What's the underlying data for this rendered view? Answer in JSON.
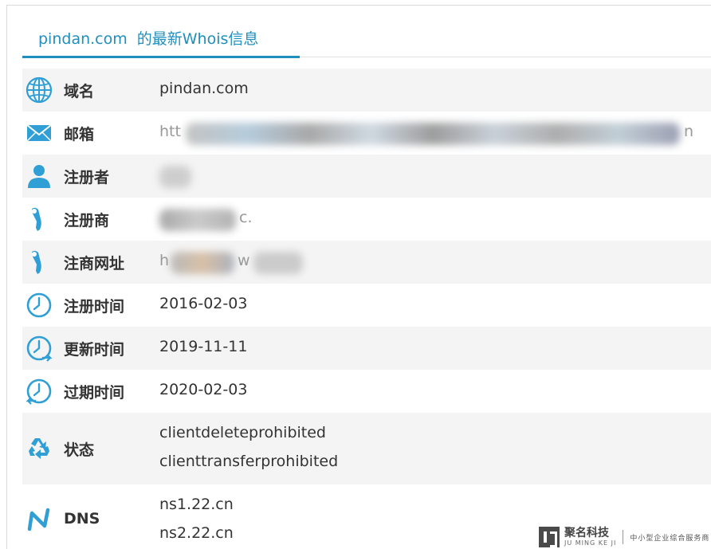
{
  "header": {
    "domain": "pindan.com",
    "suffix": "的最新Whois信息"
  },
  "colors": {
    "accent": "#1f8fbf",
    "row_alt": "#f4f4f4"
  },
  "rows": [
    {
      "icon": "globe-icon",
      "label": "域名",
      "value": "pindan.com"
    },
    {
      "icon": "mail-icon",
      "label": "邮箱",
      "value_prefix": "htt",
      "value_suffix": "n"
    },
    {
      "icon": "person-icon",
      "label": "注册者",
      "value": ""
    },
    {
      "icon": "pin-icon",
      "label": "注册商",
      "value_suffix": "c."
    },
    {
      "icon": "pin-icon",
      "label": "注商网址",
      "value_prefix": "h",
      "value_suffix": "w"
    },
    {
      "icon": "clock-icon",
      "label": "注册时间",
      "value": "2016-02-03"
    },
    {
      "icon": "clock-forward-icon",
      "label": "更新时间",
      "value": "2019-11-11"
    },
    {
      "icon": "clock-back-icon",
      "label": "过期时间",
      "value": "2020-02-03"
    },
    {
      "icon": "recycle-icon",
      "label": "状态",
      "values": [
        "clientdeleteprohibited",
        "clienttransferprohibited"
      ]
    },
    {
      "icon": "dns-icon",
      "label": "DNS",
      "values": [
        "ns1.22.cn",
        "ns2.22.cn"
      ]
    }
  ],
  "watermark": {
    "name_cn": "聚名科技",
    "name_en": "JU MING KE JI",
    "slogan": "中小型企业综合服务商"
  }
}
